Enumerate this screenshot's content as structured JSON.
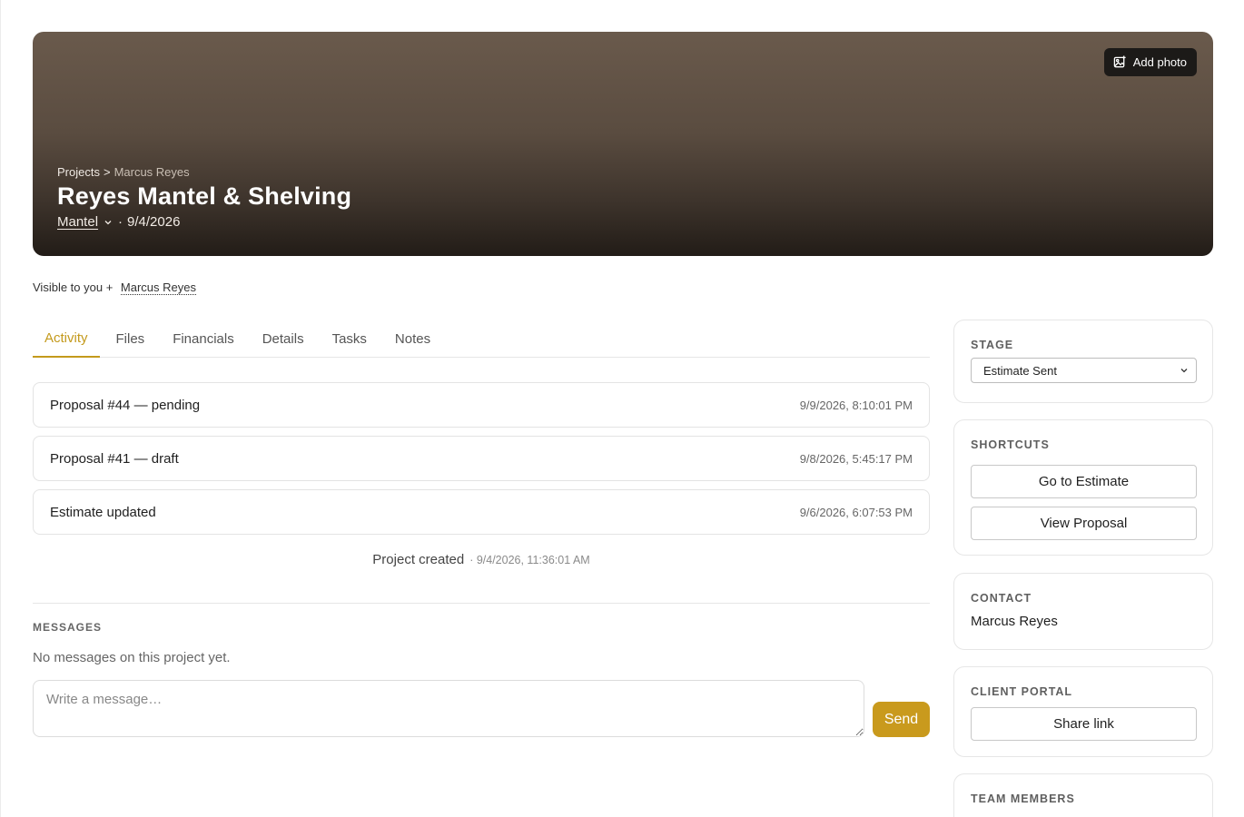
{
  "hero": {
    "add_photo": "Add photo",
    "breadcrumb": {
      "root": "Projects",
      "separator": ">",
      "current": "Marcus Reyes"
    },
    "title": "Reyes Mantel & Shelving",
    "type": "Mantel",
    "date": "9/4/2026",
    "date_separator": "·"
  },
  "visibility": {
    "prefix": "Visible to you +",
    "person": "Marcus Reyes"
  },
  "tabs": [
    {
      "label": "Activity",
      "active": true
    },
    {
      "label": "Files"
    },
    {
      "label": "Financials"
    },
    {
      "label": "Details"
    },
    {
      "label": "Tasks"
    },
    {
      "label": "Notes"
    }
  ],
  "activity": [
    {
      "title": "Proposal #44 — pending",
      "timestamp": "9/9/2026, 8:10:01 PM"
    },
    {
      "title": "Proposal #41 — draft",
      "timestamp": "9/8/2026, 5:45:17 PM"
    },
    {
      "title": "Estimate updated",
      "timestamp": "9/6/2026, 6:07:53 PM"
    }
  ],
  "created": {
    "label": "Project created",
    "timestamp": "· 9/4/2026, 11:36:01 AM"
  },
  "messages": {
    "title": "MESSAGES",
    "empty": "No messages on this project yet.",
    "placeholder": "Write a message…",
    "send": "Send"
  },
  "sidebar": {
    "stage": {
      "title": "STAGE",
      "value": "Estimate Sent"
    },
    "shortcuts": {
      "title": "SHORTCUTS",
      "go_estimate": "Go to Estimate",
      "view_proposal": "View Proposal"
    },
    "contact": {
      "title": "CONTACT",
      "name": "Marcus Reyes"
    },
    "portal": {
      "title": "CLIENT PORTAL",
      "share": "Share link"
    },
    "team": {
      "title": "TEAM MEMBERS"
    }
  },
  "colors": {
    "accent": "#c99a1d",
    "hero_top": "#6a5a4c",
    "hero_bottom": "#221c17"
  },
  "icons": {
    "add_photo": "image-plus-icon",
    "chevron": "chevron-down-icon"
  }
}
